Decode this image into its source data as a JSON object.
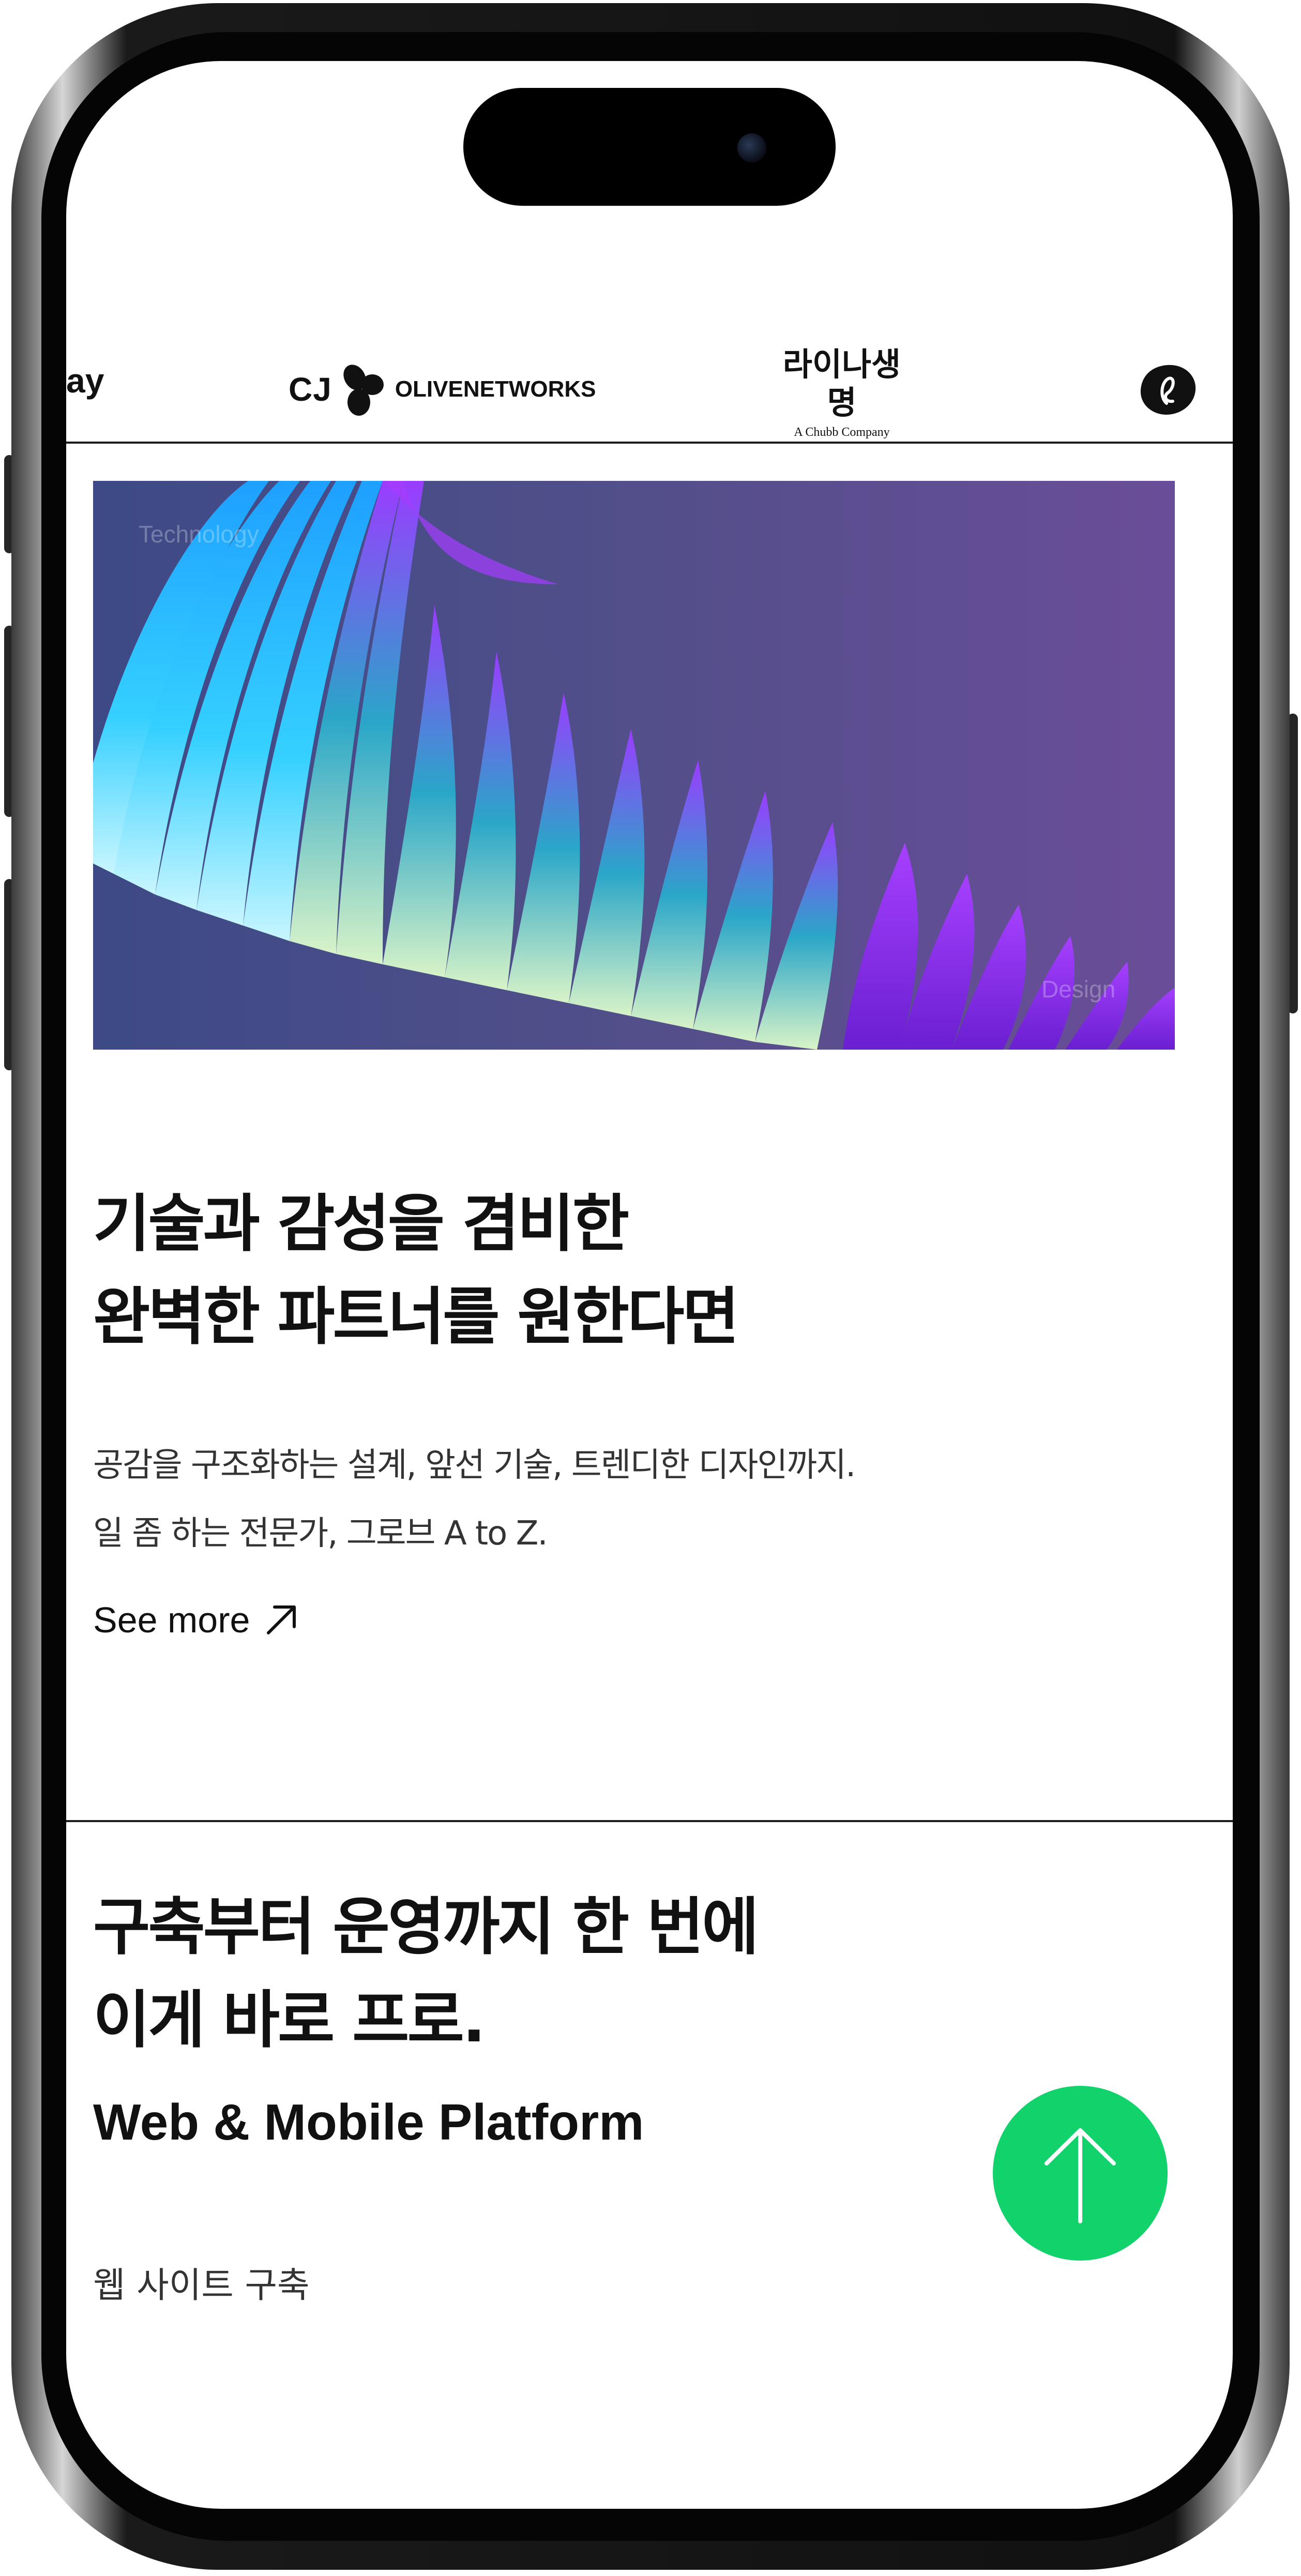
{
  "logos": {
    "partial_text": "ay",
    "cj_prefix": "CJ",
    "cj_name": "OLIVENETWORKS",
    "lina_name": "라이나생명",
    "lina_tagline": "A Chubb Company",
    "blob_icon": "brand-blob-icon"
  },
  "hero": {
    "tag_left": "Technology",
    "tag_right": "Design"
  },
  "intro": {
    "headline_line1": "기술과 감성을 겸비한",
    "headline_line2": "완벽한 파트너를 원한다면",
    "desc_line1": "공감을 구조화하는 설계, 앞선 기술, 트렌디한 디자인까지.",
    "desc_line2": "일 좀 하는 전문가, 그로브 A to Z.",
    "see_more": "See more"
  },
  "services": {
    "headline_line1": "구축부터 운영까지 한 번에",
    "headline_line2": "이게 바로 프로.",
    "subheading": "Web & Mobile Platform",
    "item": "웹 사이트 구축"
  },
  "colors": {
    "accent_green": "#12d36b",
    "text": "#111111",
    "hero_purple": "#8a2be2",
    "hero_cyan": "#27c6ff"
  },
  "icons": {
    "see_more": "arrow-up-right-icon",
    "top_button": "arrow-up-icon"
  }
}
